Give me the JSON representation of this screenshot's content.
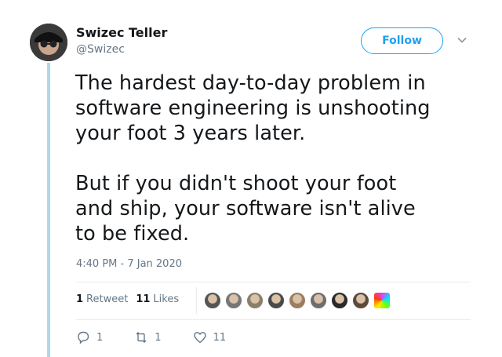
{
  "author": {
    "name": "Swizec Teller",
    "handle": "@Swizec"
  },
  "follow_label": "Follow",
  "tweet": {
    "text": "The hardest day-to-day problem in\nsoftware engineering is unshooting\nyour foot 3 years later.\n\nBut if you didn't shoot your foot\nand ship, your software isn't alive\nto be fixed.",
    "timestamp": "4:40 PM - 7 Jan 2020"
  },
  "stats": {
    "retweets_count": "1",
    "retweets_label": "Retweet",
    "likes_count": "11",
    "likes_label": "Likes"
  },
  "liker_avatar_colors": [
    "#555555",
    "#777777",
    "#8a7f6a",
    "#4a4a4a",
    "#9b7d5f",
    "#6e6e6e",
    "#2a2a2a",
    "#5c4a3a",
    "#e040fb"
  ],
  "actions": {
    "reply_count": "1",
    "retweet_count": "1",
    "like_count": "11"
  },
  "colors": {
    "accent": "#1da1f2",
    "muted": "#657786",
    "thread": "#b3d7e6"
  }
}
